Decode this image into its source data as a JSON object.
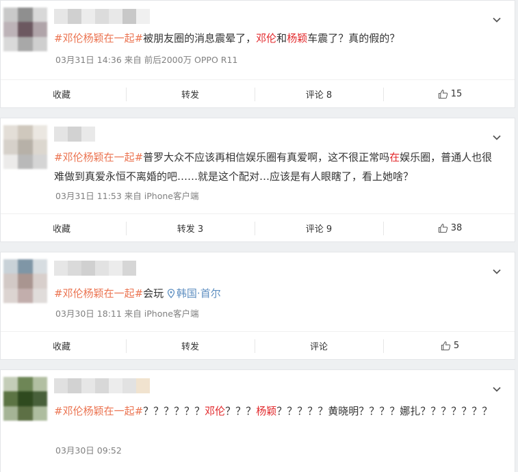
{
  "posts": [
    {
      "avatar_colors": [
        "#c9c9c9",
        "#8f8f8f",
        "#d8d8d8",
        "#bdb3b8",
        "#6c5860",
        "#b0a4a9",
        "#d9d9d9",
        "#a8a8a8",
        "#cfcfcf"
      ],
      "name_colors": [
        "#e6e6e6",
        "#d0d0d0",
        "#ececec",
        "#dcdcdc",
        "#e8e8e8",
        "#c8c8c8",
        "#f0f0f0"
      ],
      "content": [
        {
          "t": "#邓伦杨颖在一起#",
          "c": "topic"
        },
        {
          "t": "被朋友圈的消息震晕了，",
          "c": ""
        },
        {
          "t": "邓伦",
          "c": "hl"
        },
        {
          "t": "和",
          "c": ""
        },
        {
          "t": "杨颖",
          "c": "hl"
        },
        {
          "t": "车震了？真的假的？",
          "c": ""
        }
      ],
      "meta": "03月31日 14:36 来自 前后2000万 OPPO R11",
      "actions": {
        "fav": "收藏",
        "forward": "转发",
        "comment": "评论 8",
        "like": "15"
      }
    },
    {
      "avatar_colors": [
        "#e3ded7",
        "#cfc8bd",
        "#ebe7e1",
        "#d6d1ca",
        "#b7b1a8",
        "#dcd7cf",
        "#ecebea",
        "#b9b9b9",
        "#d5d5d5"
      ],
      "name_colors": [
        "#e4e4e4",
        "#d2d2d2",
        "#e9e9e9"
      ],
      "content": [
        {
          "t": "#邓伦杨颖在一起#",
          "c": "topic"
        },
        {
          "t": "普罗大众不应该再相信娱乐圈有真爱啊，这不很正常吗",
          "c": ""
        },
        {
          "t": "在",
          "c": "hl"
        },
        {
          "t": "娱乐圈，普通人也很难做到真爱永恒不离婚的吧……就是这个配对…应该是有人眼瞎了，看上她啥？",
          "c": ""
        }
      ],
      "meta": "03月31日 11:53 来自 iPhone客户端",
      "actions": {
        "fav": "收藏",
        "forward": "转发 3",
        "comment": "评论 9",
        "like": "38"
      }
    },
    {
      "avatar_colors": [
        "#c9d2d8",
        "#7f96a6",
        "#d7dde1",
        "#d2c9c6",
        "#a99590",
        "#d8cfcc",
        "#dcd4d1",
        "#c2aeac",
        "#e0dcda"
      ],
      "name_colors": [
        "#e6e6e6",
        "#dadada",
        "#d0d0d0",
        "#e2e2e2",
        "#ececec",
        "#d6d6d6"
      ],
      "content": [
        {
          "t": "#邓伦杨颖在一起#",
          "c": "topic"
        },
        {
          "t": "会玩 ",
          "c": ""
        },
        {
          "t": "韩国·首尔",
          "c": "loc"
        }
      ],
      "meta": "03月30日 18:11 来自 iPhone客户端",
      "actions": {
        "fav": "收藏",
        "forward": "转发",
        "comment": "评论",
        "like": "5"
      }
    },
    {
      "avatar_colors": [
        "#c4cdb8",
        "#6e8656",
        "#b2bfa2",
        "#5c7444",
        "#2f4a1f",
        "#48603a",
        "#a5b496",
        "#5d7045",
        "#aebd9f"
      ],
      "name_colors": [
        "#e0e0e0",
        "#d2d2d2",
        "#e6e6e6",
        "#d8d8d8",
        "#ececec",
        "#e2e2e2",
        "#f1e3cf"
      ],
      "content": [
        {
          "t": "#邓伦杨颖在一起#",
          "c": "topic"
        },
        {
          "t": "？？？？？？",
          "c": ""
        },
        {
          "t": "邓伦",
          "c": "hl"
        },
        {
          "t": "？？？",
          "c": ""
        },
        {
          "t": "杨颖",
          "c": "hl"
        },
        {
          "t": "？？？？？黄晓明？？？？娜扎？？？？？？？",
          "c": ""
        }
      ],
      "meta": "03月30日 09:52",
      "actions": null
    }
  ]
}
